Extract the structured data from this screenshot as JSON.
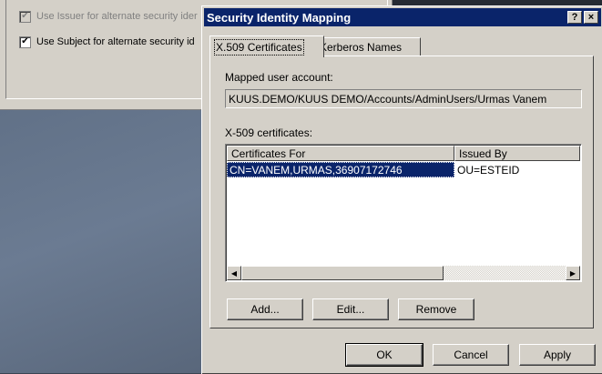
{
  "background_window": {
    "checkbox_issuer_label": "Use Issuer for alternate security ider",
    "checkbox_issuer_checked": true,
    "checkbox_subject_label": "Use Subject for alternate security id",
    "checkbox_subject_checked": true
  },
  "dialog": {
    "title": "Security Identity Mapping",
    "help_label": "?",
    "close_label": "×",
    "tabs": [
      {
        "label": "X.509 Certificates",
        "active": true
      },
      {
        "label": "Kerberos Names",
        "active": false
      }
    ],
    "mapped_account_label": "Mapped user account:",
    "mapped_account_value": "KUUS.DEMO/KUUS DEMO/Accounts/AdminUsers/Urmas Vanem",
    "certificates_label": "X-509 certificates:",
    "columns": [
      "Certificates For",
      "Issued By"
    ],
    "rows": [
      {
        "certificates_for": "CN=VANEM,URMAS,36907172746",
        "issued_by": "OU=ESTEID",
        "selected": true
      }
    ],
    "buttons": {
      "add": "Add...",
      "edit": "Edit...",
      "remove": "Remove",
      "ok": "OK",
      "cancel": "Cancel",
      "apply": "Apply"
    },
    "colors": {
      "title_bar": "#0a246a",
      "face": "#d4d0c8",
      "selection": "#0a246a"
    }
  }
}
